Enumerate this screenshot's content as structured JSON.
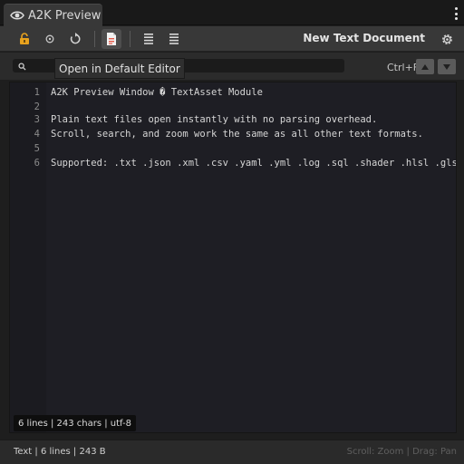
{
  "tab": {
    "title": "A2K Preview",
    "icon": "eye-icon"
  },
  "toolbar": {
    "document_title": "New Text Document",
    "icons": [
      "lock-open-icon",
      "circle-icon",
      "refresh-icon",
      "open-in-editor-icon",
      "align-lines-icon",
      "align-lines-icon",
      "gear-icon"
    ]
  },
  "search": {
    "placeholder": "",
    "value": "",
    "hotkey": "Ctrl+F"
  },
  "tooltip": {
    "text": "Open in Default Editor"
  },
  "editor": {
    "lines": [
      {
        "n": "1",
        "text": "A2K Preview Window � TextAsset Module"
      },
      {
        "n": "2",
        "text": ""
      },
      {
        "n": "3",
        "text": "Plain text files open instantly with no parsing overhead."
      },
      {
        "n": "4",
        "text": "Scroll, search, and zoom work the same as all other text formats."
      },
      {
        "n": "5",
        "text": ""
      },
      {
        "n": "6",
        "text": "Supported: .txt .json .xml .csv .yaml .yml .log .sql .shader .hlsl .glsl"
      }
    ],
    "stats": "6 lines | 243 chars | utf-8"
  },
  "footer": {
    "info": "Text | 6 lines | 243 B",
    "hint": "Scroll: Zoom | Drag: Pan"
  },
  "colors": {
    "lock_icon": "#e8a21e",
    "document_icon": "#e65a4a",
    "background": "#1e1e1e"
  }
}
